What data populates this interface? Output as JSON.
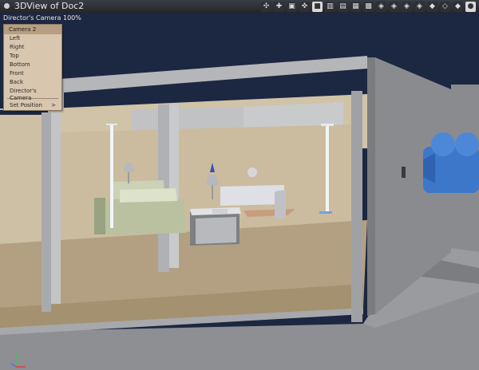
{
  "window": {
    "title": "3DView of Doc2"
  },
  "toolbar": {
    "icons": [
      "lasso-select-icon",
      "zoom-icon",
      "view-toggle-icon",
      "rotate-icon",
      "single-view-icon",
      "two-view-icon",
      "three-view-icon",
      "four-view-icon",
      "quad-view-icon",
      "nav-1-icon",
      "nav-2-icon",
      "nav-3-icon",
      "nav-4-icon",
      "solid-cube-icon",
      "wire-cube-icon",
      "shade-cube-icon",
      "sphere-icon"
    ]
  },
  "viewport": {
    "camera_label": "Director's Camera 100%"
  },
  "camera_menu": {
    "header": "Camera 2",
    "items": [
      "Left",
      "Right",
      "Top",
      "Bottom",
      "Front",
      "Back",
      "Director's Camera"
    ],
    "submenu_item": "Set Position to...",
    "submenu_arrow": ">"
  }
}
